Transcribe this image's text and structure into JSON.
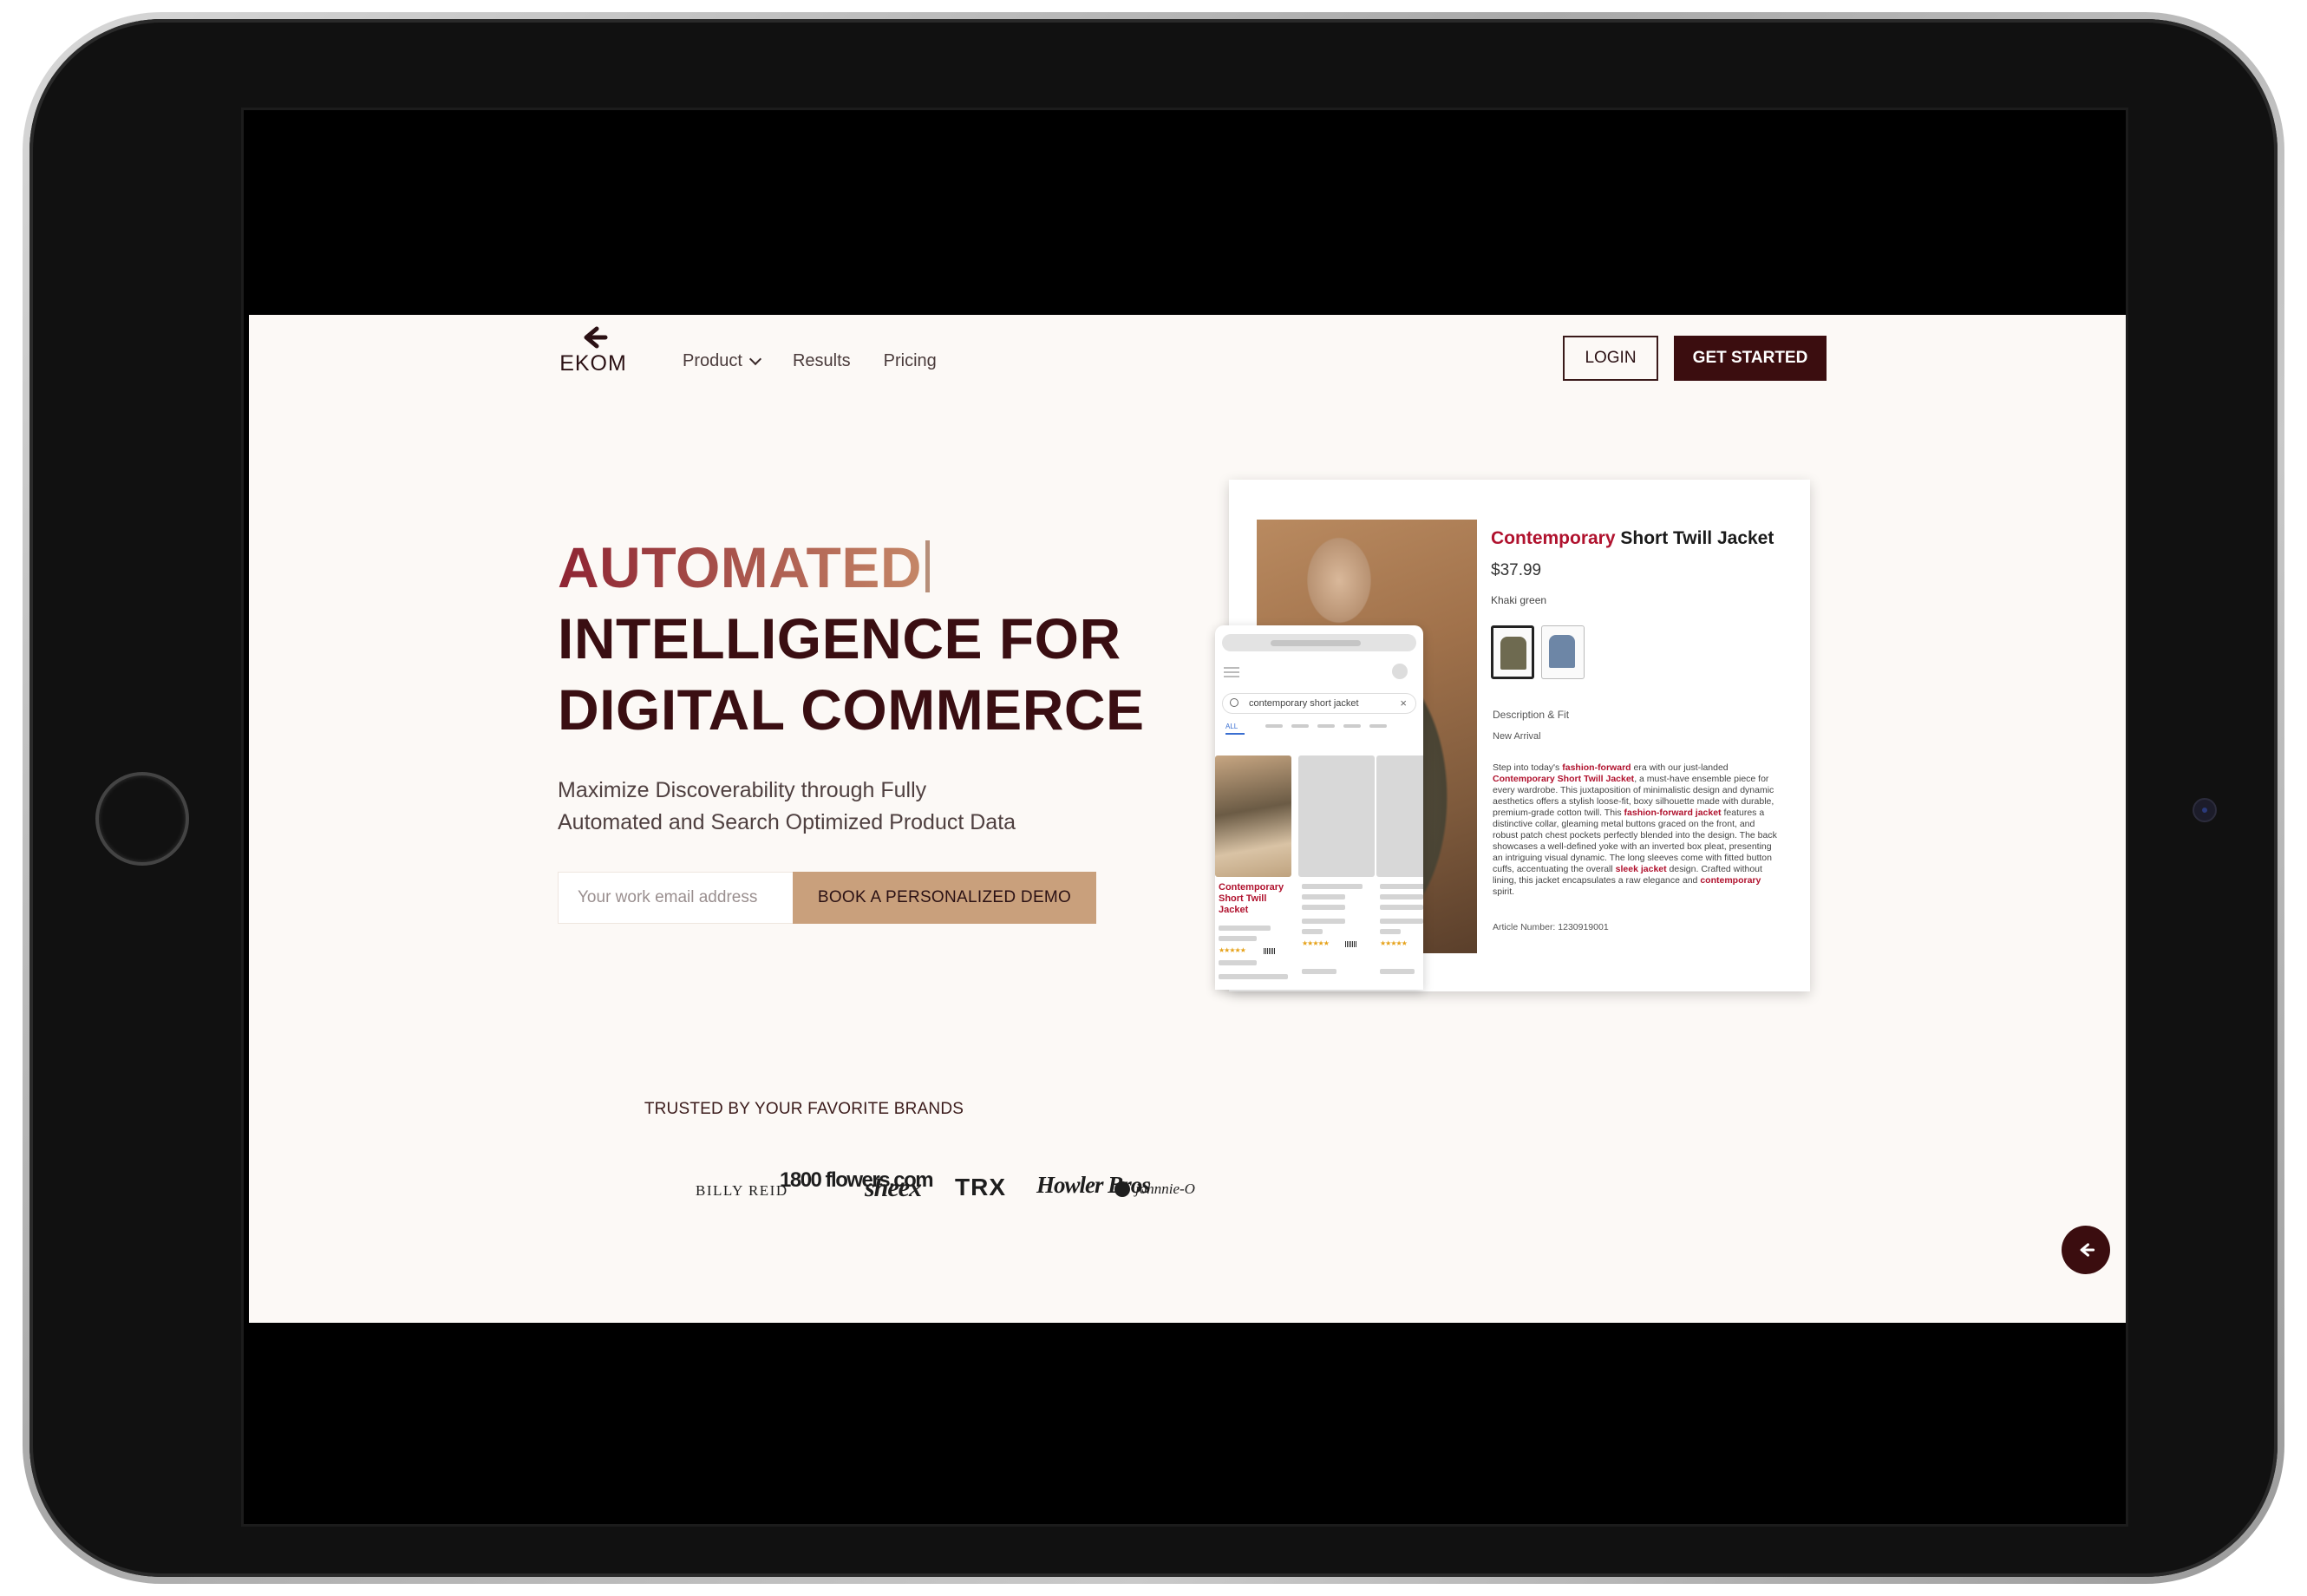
{
  "header": {
    "logo_text": "EKOM",
    "nav": [
      {
        "label": "Product",
        "has_dropdown": true
      },
      {
        "label": "Results"
      },
      {
        "label": "Pricing"
      }
    ],
    "login_label": "LOGIN",
    "get_started_label": "GET STARTED"
  },
  "hero": {
    "title_accent": "AUTOMATED",
    "title_line2": "INTELLIGENCE FOR",
    "title_line3": "DIGITAL COMMERCE",
    "subtitle_line1": "Maximize Discoverability through Fully",
    "subtitle_line2": "Automated and Search Optimized Product Data",
    "email_placeholder": "Your work email address",
    "demo_button": "BOOK A PERSONALIZED DEMO"
  },
  "mockup": {
    "product_title_accent": "Contemporary",
    "product_title_rest": " Short Twill Jacket",
    "price": "$37.99",
    "color_name": "Khaki green",
    "description_heading": "Description & Fit",
    "new_arrival": "New Arrival",
    "body_parts": [
      "Step into today's ",
      "fashion-forward",
      " era with our just-landed ",
      "Contemporary Short Twill Jacket",
      ", a must-have ensemble piece for every wardrobe. This juxtaposition of minimalistic design and dynamic aesthetics offers a stylish loose-fit, boxy silhouette made with durable, premium-grade cotton twill. This ",
      "fashion-forward jacket",
      " features a distinctive collar, gleaming metal buttons graced on the front, and robust patch chest pockets perfectly blended into the design. The back showcases a well-defined yoke with an inverted box pleat, presenting an intriguing visual dynamic. The long sleeves come with fitted button cuffs, accentuating the overall ",
      "sleek jacket",
      " design. Crafted without lining, this jacket encapsulates a raw elegance and ",
      "contemporary",
      " spirit."
    ],
    "article_number": "Article Number: 1230919001",
    "phone_search_query": "contemporary short jacket",
    "phone_tab_all": "ALL",
    "result_card_name": "Contemporary Short Twill Jacket",
    "stars": "★★★★★"
  },
  "brands": {
    "heading": "TRUSTED BY YOUR FAVORITE BRANDS",
    "logos": [
      "BILLY REID",
      "1800 flowers.com",
      "sheex",
      "TRX",
      "Howler Bros",
      "johnnie-O"
    ]
  },
  "colors": {
    "brand_dark": "#3b0d0f",
    "accent_red": "#b0122e",
    "demo_button": "#c9a07c",
    "page_bg": "#fcf9f6"
  }
}
